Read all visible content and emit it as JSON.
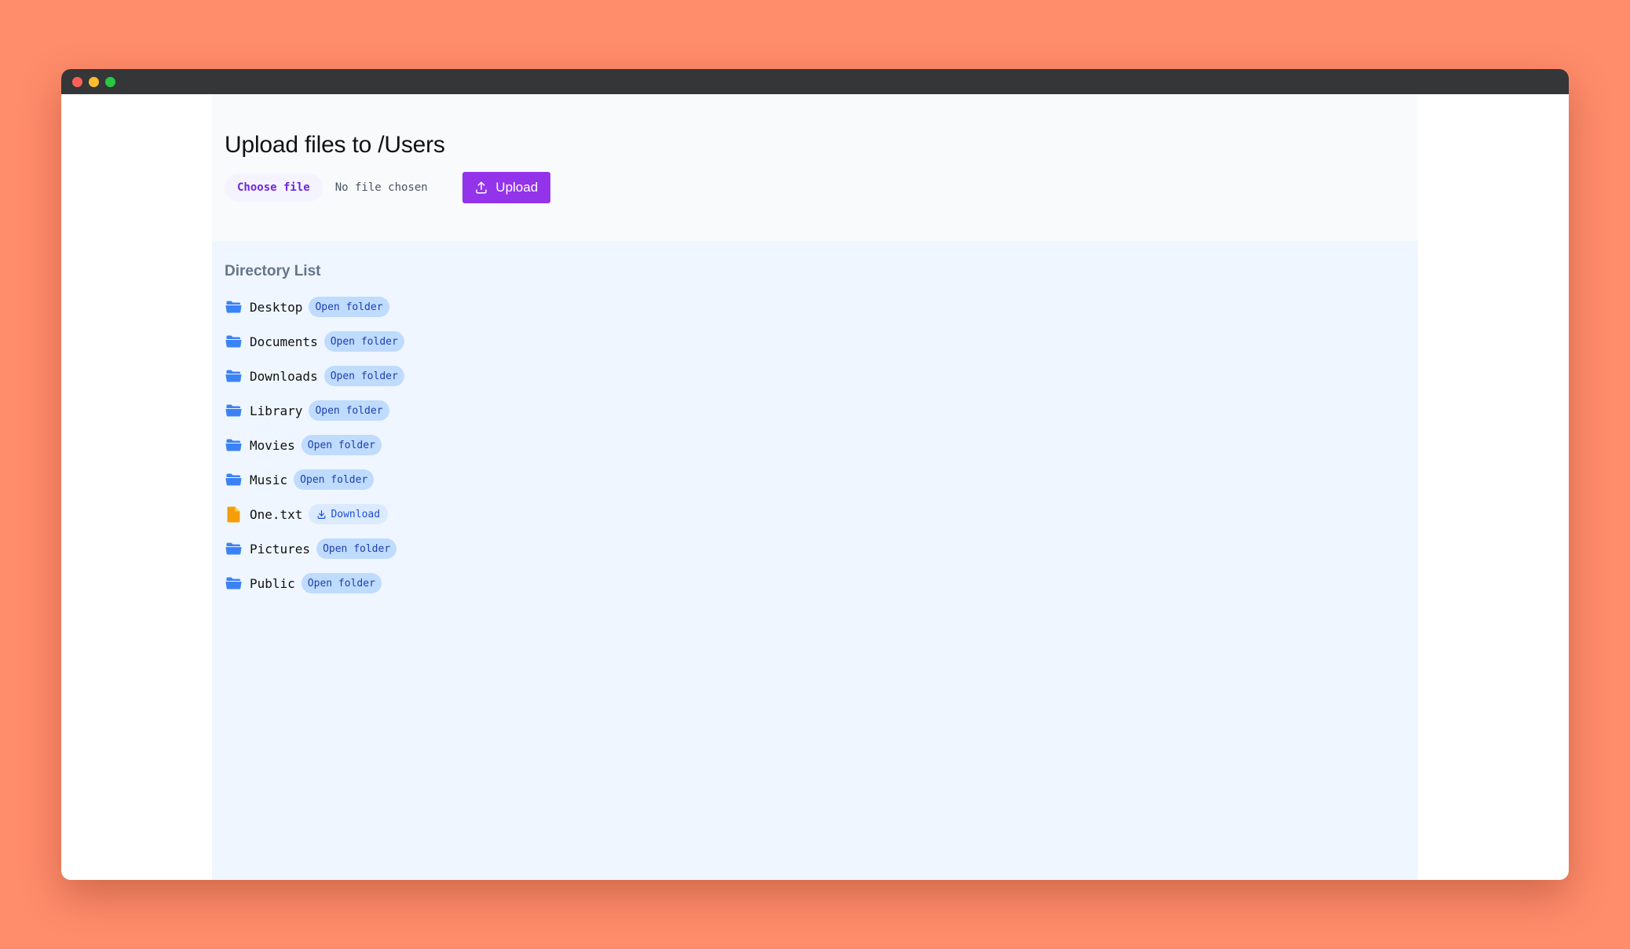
{
  "page": {
    "title": "Upload files to /Users"
  },
  "upload": {
    "choose_label": "Choose file",
    "status": "No file chosen",
    "button_label": "Upload"
  },
  "directory": {
    "title": "Directory List",
    "items": [
      {
        "name": "Desktop",
        "type": "folder",
        "icon": "folder-icon",
        "action": "Open folder"
      },
      {
        "name": "Documents",
        "type": "folder",
        "icon": "folder-icon",
        "action": "Open folder"
      },
      {
        "name": "Downloads",
        "type": "folder",
        "icon": "folder-icon",
        "action": "Open folder"
      },
      {
        "name": "Library",
        "type": "folder",
        "icon": "folder-icon",
        "action": "Open folder"
      },
      {
        "name": "Movies",
        "type": "folder",
        "icon": "folder-icon",
        "action": "Open folder"
      },
      {
        "name": "Music",
        "type": "folder",
        "icon": "folder-icon",
        "action": "Open folder"
      },
      {
        "name": "One.txt",
        "type": "file",
        "icon": "file-icon",
        "action": "Download"
      },
      {
        "name": "Pictures",
        "type": "folder",
        "icon": "folder-icon",
        "action": "Open folder"
      },
      {
        "name": "Public",
        "type": "folder",
        "icon": "folder-icon",
        "action": "Open folder"
      }
    ]
  },
  "colors": {
    "background": "#ff8c6b",
    "titlebar": "#353638",
    "accent": "#9333ea",
    "folder": "#3b82f6",
    "file": "#f59e0b"
  }
}
